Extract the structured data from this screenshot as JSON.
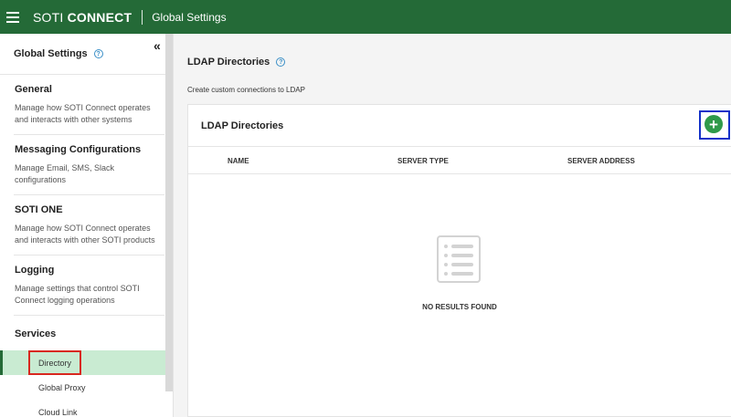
{
  "header": {
    "brand_light": "SOTI",
    "brand_bold": "CONNECT",
    "title": "Global Settings"
  },
  "sidebar": {
    "title": "Global Settings",
    "collapse_glyph": "«",
    "sections": [
      {
        "title": "General",
        "description": "Manage how SOTI Connect operates and interacts with other systems"
      },
      {
        "title": "Messaging Configurations",
        "description": "Manage Email, SMS, Slack configurations"
      },
      {
        "title": "SOTI ONE",
        "description": "Manage how SOTI Connect operates and interacts with other SOTI products"
      },
      {
        "title": "Logging",
        "description": "Manage settings that control SOTI Connect logging operations"
      }
    ],
    "services": {
      "title": "Services",
      "items": [
        {
          "label": "Directory",
          "active": true
        },
        {
          "label": "Global Proxy",
          "active": false
        },
        {
          "label": "Cloud Link",
          "active": false
        }
      ]
    }
  },
  "main": {
    "title": "LDAP Directories",
    "subtitle": "Create custom connections to LDAP",
    "panel": {
      "title": "LDAP Directories",
      "add_glyph": "+",
      "columns": [
        "NAME",
        "SERVER TYPE",
        "SERVER ADDRESS"
      ],
      "empty_text": "NO RESULTS FOUND"
    }
  },
  "colors": {
    "topbar": "#246a37",
    "active_item_bg": "#c9ebd2",
    "add_button": "#2f9a4a",
    "highlight_red": "#d8281f",
    "highlight_blue": "#1431c8",
    "help_icon": "#3a8fc7"
  },
  "icons": [
    "hamburger-menu-icon",
    "help-circle-icon",
    "double-chevron-left-icon",
    "plus-circle-icon",
    "empty-list-icon"
  ]
}
